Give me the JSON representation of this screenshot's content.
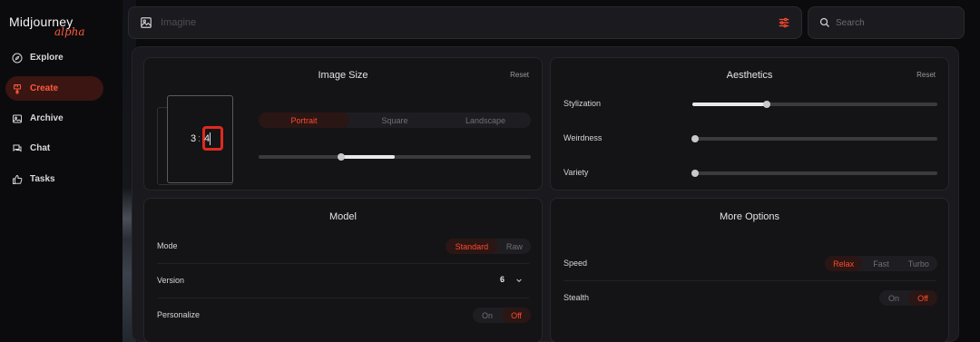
{
  "brand": {
    "name": "Midjourney",
    "tag": "alpha",
    "accent": "#ff4a2e"
  },
  "sidebar": {
    "items": [
      {
        "label": "Explore",
        "icon": "compass-icon",
        "active": false
      },
      {
        "label": "Create",
        "icon": "brush-icon",
        "active": true
      },
      {
        "label": "Archive",
        "icon": "image-icon",
        "active": false
      },
      {
        "label": "Chat",
        "icon": "chat-icon",
        "active": false
      },
      {
        "label": "Tasks",
        "icon": "thumbs-up-icon",
        "active": false
      }
    ]
  },
  "imagine": {
    "placeholder": "Imagine"
  },
  "search": {
    "placeholder": "Search"
  },
  "image_size": {
    "title": "Image Size",
    "reset": "Reset",
    "ratio_w": "3",
    "ratio_sep": ":",
    "ratio_h": "4",
    "orientation": {
      "options": [
        "Portrait",
        "Square",
        "Landscape"
      ],
      "selected": "Portrait"
    },
    "slider_value": 0.3
  },
  "aesthetics": {
    "title": "Aesthetics",
    "reset": "Reset",
    "rows": [
      {
        "label": "Stylization",
        "value": 0.3
      },
      {
        "label": "Weirdness",
        "value": 0.0
      },
      {
        "label": "Variety",
        "value": 0.0
      }
    ]
  },
  "model": {
    "title": "Model",
    "mode": {
      "label": "Mode",
      "options": [
        "Standard",
        "Raw"
      ],
      "selected": "Standard"
    },
    "version": {
      "label": "Version",
      "value": "6"
    },
    "personalize": {
      "label": "Personalize",
      "options": [
        "On",
        "Off"
      ],
      "selected": "Off"
    }
  },
  "more_options": {
    "title": "More Options",
    "speed": {
      "label": "Speed",
      "options": [
        "Relax",
        "Fast",
        "Turbo"
      ],
      "selected": "Relax"
    },
    "stealth": {
      "label": "Stealth",
      "options": [
        "On",
        "Off"
      ],
      "selected": "Off"
    }
  }
}
